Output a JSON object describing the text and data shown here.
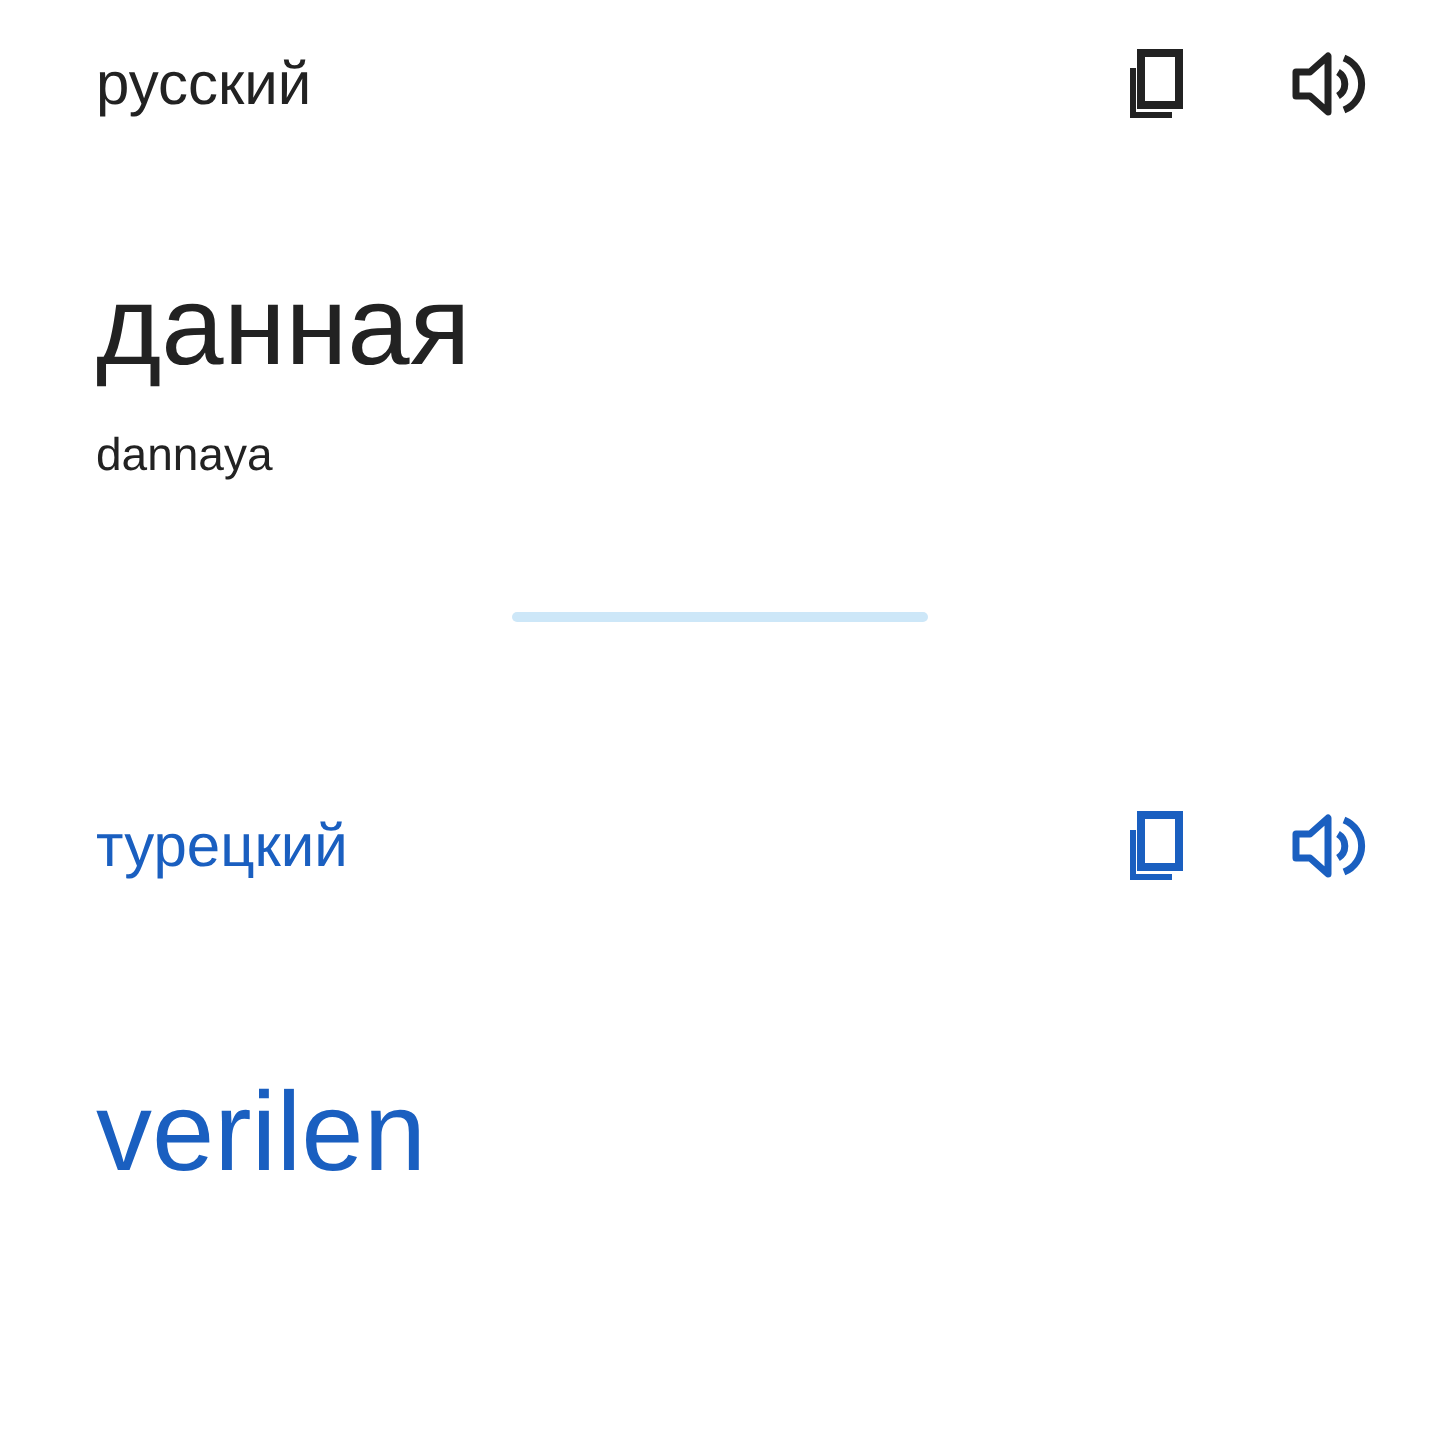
{
  "source": {
    "language": "русский",
    "text": "данная",
    "transliteration": "dannaya"
  },
  "target": {
    "language": "турецкий",
    "text": "verilen"
  }
}
